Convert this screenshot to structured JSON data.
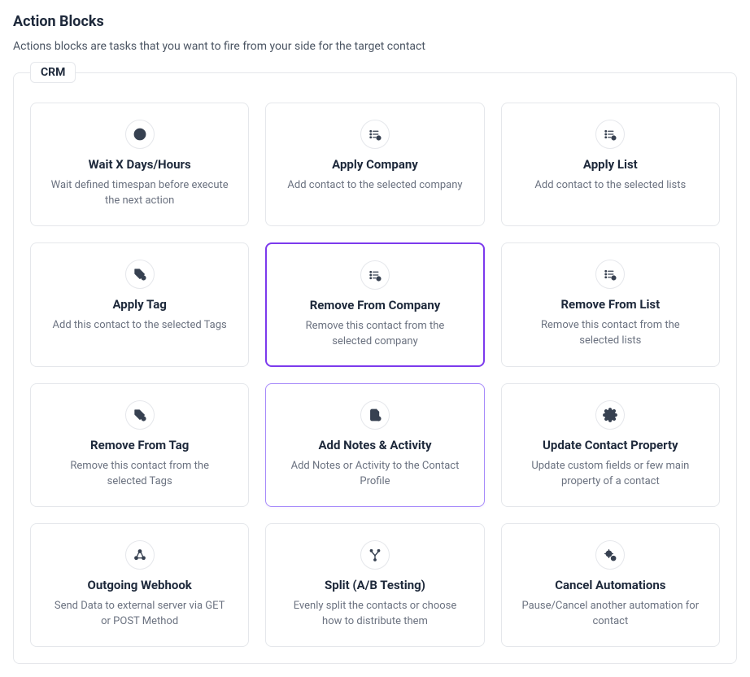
{
  "page": {
    "title": "Action Blocks",
    "subtitle": "Actions blocks are tasks that you want to fire from your side for the target contact"
  },
  "section": {
    "legend": "CRM"
  },
  "cards": {
    "wait": {
      "title": "Wait X Days/Hours",
      "desc": "Wait defined timespan before execute the next action"
    },
    "applyCompany": {
      "title": "Apply Company",
      "desc": "Add contact to the selected company"
    },
    "applyList": {
      "title": "Apply List",
      "desc": "Add contact to the selected lists"
    },
    "applyTag": {
      "title": "Apply Tag",
      "desc": "Add this contact to the selected Tags"
    },
    "removeCompany": {
      "title": "Remove From Company",
      "desc": "Remove this contact from the selected company"
    },
    "removeList": {
      "title": "Remove From List",
      "desc": "Remove this contact from the selected lists"
    },
    "removeTag": {
      "title": "Remove From Tag",
      "desc": "Remove this contact from the selected Tags"
    },
    "addNotes": {
      "title": "Add Notes & Activity",
      "desc": "Add Notes or Activity to the Contact Profile"
    },
    "updateProperty": {
      "title": "Update Contact Property",
      "desc": "Update custom fields or few main property of a contact"
    },
    "webhook": {
      "title": "Outgoing Webhook",
      "desc": "Send Data to external server via GET or POST Method"
    },
    "split": {
      "title": "Split (A/B Testing)",
      "desc": "Evenly split the contacts or choose how to distribute them"
    },
    "cancel": {
      "title": "Cancel Automations",
      "desc": "Pause/Cancel another automation for contact"
    }
  }
}
